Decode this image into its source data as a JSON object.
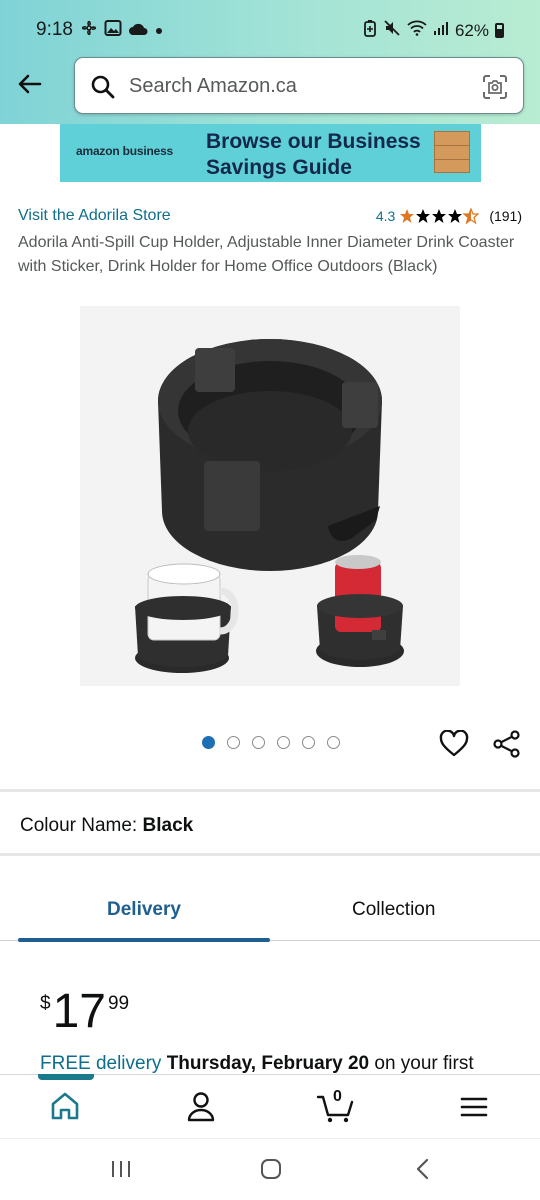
{
  "status_bar": {
    "time": "9:18",
    "battery": "62%"
  },
  "header": {
    "search": {
      "placeholder": "Search Amazon.ca"
    }
  },
  "banner": {
    "logo_text": "amazon business",
    "text": "Browse our Business Savings Guide"
  },
  "product": {
    "store_link": "Visit the Adorila Store",
    "rating": "4.3",
    "stars": 4.3,
    "review_count": "(191)",
    "title": "Adorila Anti-Spill Cup Holder, Adjustable Inner Diameter Drink Coaster with Sticker, Drink Holder for Home Office Outdoors (Black)",
    "image_count": 6,
    "active_image": 1
  },
  "variation": {
    "label": "Colour Name:",
    "value": "Black"
  },
  "tabs": [
    {
      "label": "Delivery",
      "active": true
    },
    {
      "label": "Collection",
      "active": false
    }
  ],
  "price": {
    "currency": "$",
    "whole": "17",
    "fraction": "99"
  },
  "delivery": {
    "free": "FREE delivery",
    "date": "Thursday, February 20",
    "rest": "on your first"
  },
  "bottom_nav": {
    "cart_count": "0",
    "items": [
      "home-icon",
      "account-icon",
      "cart-icon",
      "menu-icon"
    ]
  },
  "colors": {
    "link": "#0f6e8c",
    "active_tab": "#1f5f8f",
    "star": "#de7921",
    "header_gradient_start": "#7fd3d6",
    "header_gradient_end": "#b9ecd2"
  }
}
